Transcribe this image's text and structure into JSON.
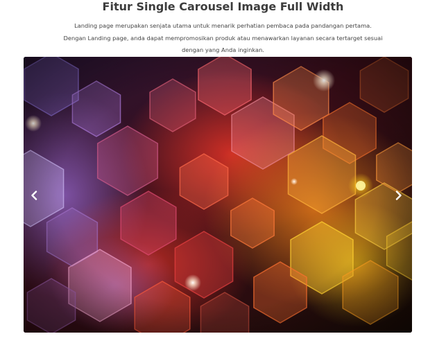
{
  "section": {
    "title": "Fitur Single Carousel Image Full Width",
    "description_lines": [
      "Landing page merupakan senjata utama untuk menarik perhatian pembaca pada pandangan pertama.",
      "Dengan Landing page, anda dapat mempromosikan produk atau menawarkan layanan secara tertarget sesuai",
      "dengan yang Anda inginkan."
    ]
  },
  "carousel": {
    "prev_icon": "chevron-left-icon",
    "next_icon": "chevron-right-icon",
    "slide_image": "hexagon-bokeh-image"
  },
  "colors": {
    "title": "#3d3d3d",
    "text": "#444444",
    "arrow": "#ffffff"
  }
}
